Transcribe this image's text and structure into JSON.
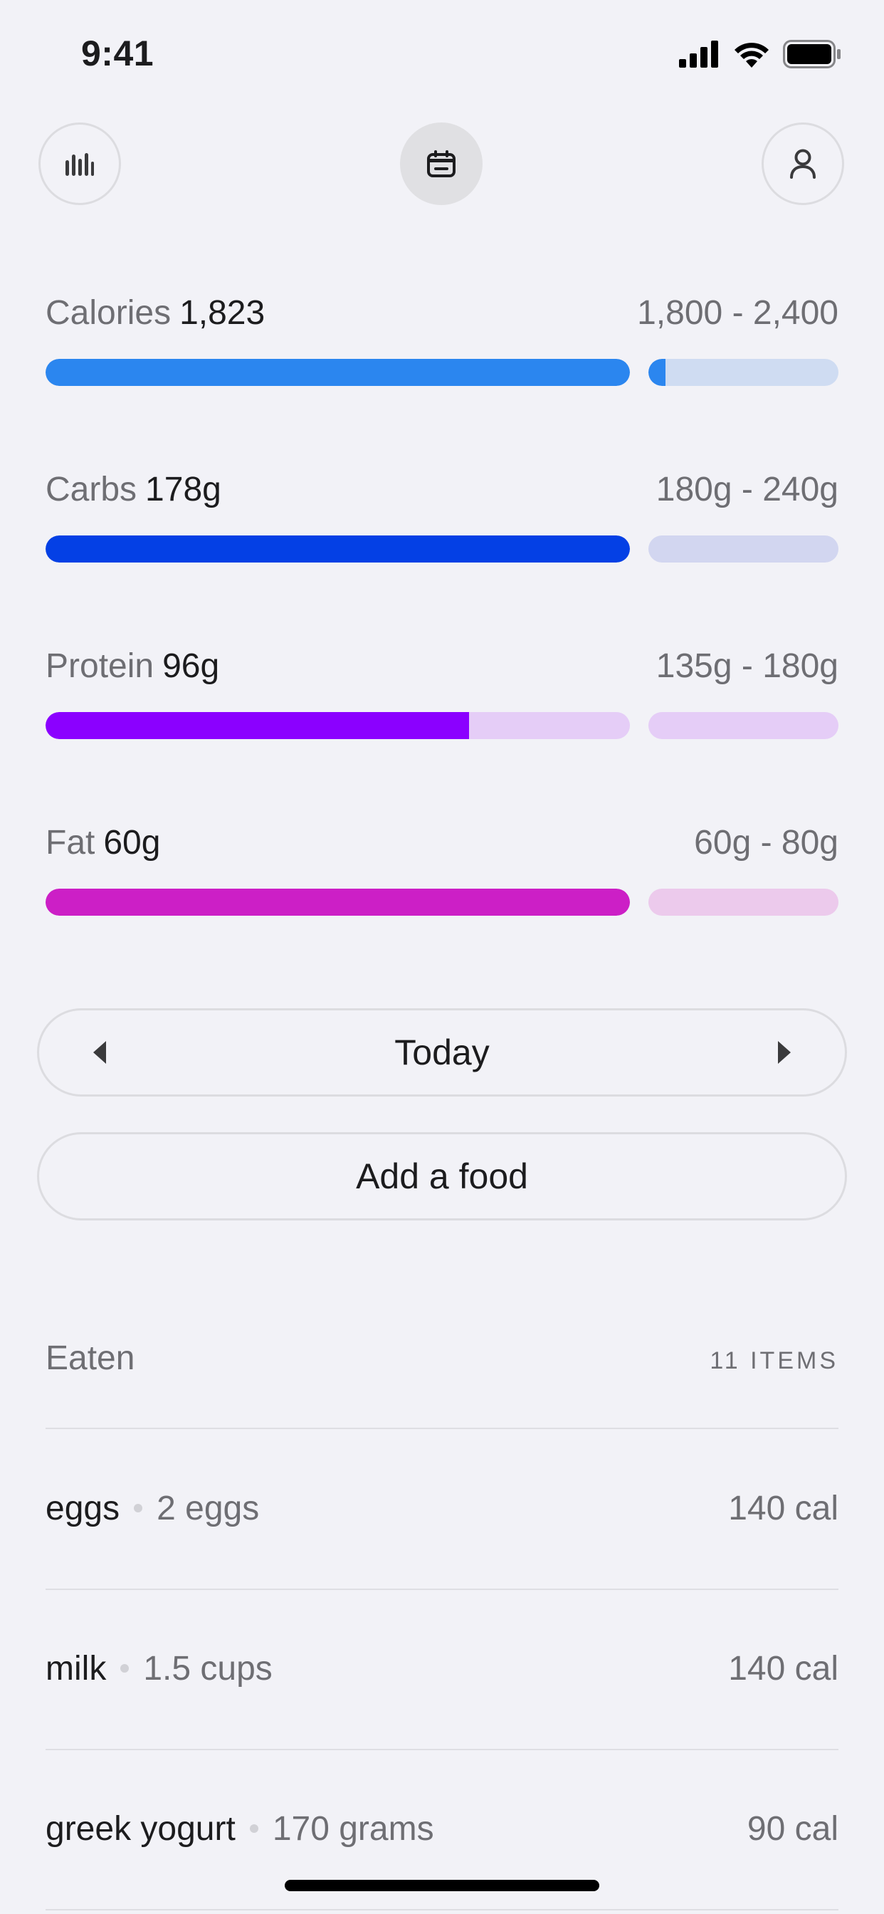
{
  "status_bar": {
    "time": "9:41"
  },
  "top_nav": [
    {
      "icon": "stats-bars-icon"
    },
    {
      "icon": "calendar-icon",
      "active": true
    },
    {
      "icon": "profile-icon"
    }
  ],
  "macros": [
    {
      "label": "Calories",
      "value": "1,823",
      "range": "1,800 - 2,400",
      "color": "#2b86ef",
      "track": "#cfdcf2",
      "main_progress": 1.0,
      "extra_progress": 0.09
    },
    {
      "label": "Carbs",
      "value": "178g",
      "range": "180g - 240g",
      "color": "#0440e5",
      "track": "#d2d6f0",
      "main_progress": 1.0,
      "extra_progress": 0.0
    },
    {
      "label": "Protein",
      "value": "96g",
      "range": "135g - 180g",
      "color": "#8b00ff",
      "track": "#e5cdf7",
      "main_progress": 0.725,
      "extra_progress": 0.0
    },
    {
      "label": "Fat",
      "value": "60g",
      "range": "60g - 80g",
      "color": "#cc1fc6",
      "track": "#eccaec",
      "main_progress": 1.0,
      "extra_progress": 0.0
    }
  ],
  "day_nav": {
    "label": "Today"
  },
  "add_food": {
    "label": "Add a food"
  },
  "eaten": {
    "title": "Eaten",
    "count": "11 ITEMS",
    "items": [
      {
        "name": "eggs",
        "quantity": "2 eggs",
        "calories": "140 cal"
      },
      {
        "name": "milk",
        "quantity": "1.5 cups",
        "calories": "140 cal"
      },
      {
        "name": "greek yogurt",
        "quantity": "170 grams",
        "calories": "90 cal"
      }
    ]
  }
}
